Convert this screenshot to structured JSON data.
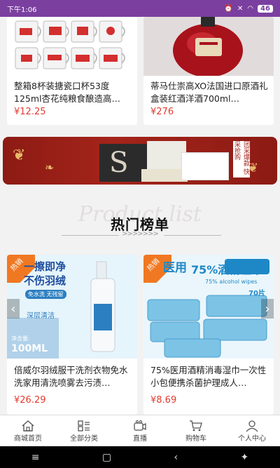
{
  "status_bar": {
    "time": "下午1:06",
    "icons": [
      "alarm-icon",
      "mute-icon",
      "wifi-icon",
      "battery-icon"
    ],
    "battery": "46"
  },
  "top_products": [
    {
      "title": "整箱8杯装搪瓷口杯53度125ml杏花纯粮食酿造高…",
      "price": "¥12.25"
    },
    {
      "title": "蒂马仕崇高XO法国进口原酒礼盒装红酒洋酒700ml…",
      "price": "¥276"
    }
  ],
  "banner": {
    "side_tag": "团采爆款 快采抢购"
  },
  "section": {
    "watermark": "Product list",
    "title": "热门榜单",
    "arrows": ">>>>>>>"
  },
  "hot_products": [
    {
      "badge": "热销",
      "img_text_1": "一擦即净",
      "img_text_2": "不伤羽绒",
      "img_text_3": "免水洗 无残留",
      "img_text_4": "深层清洁",
      "img_text_5": "净含量:",
      "img_text_6": "100ML",
      "title": "倍威尔羽绒服干洗剂衣物免水洗家用清洗喷雾去污渍…",
      "price": "¥26.29"
    },
    {
      "badge": "热销",
      "img_text_1": "医用",
      "img_text_2": "75%酒精湿巾",
      "img_text_3": "75% alcohol wipes",
      "img_text_4": "70片",
      "title": "75%医用酒精消毒湿巾一次性小包便携杀菌护理成人…",
      "price": "¥8.69"
    }
  ],
  "bottom_nav": [
    {
      "label": "商城首页",
      "icon": "home-icon"
    },
    {
      "label": "全部分类",
      "icon": "category-icon"
    },
    {
      "label": "直播",
      "icon": "live-icon"
    },
    {
      "label": "购物车",
      "icon": "cart-icon"
    },
    {
      "label": "个人中心",
      "icon": "user-icon"
    }
  ],
  "colors": {
    "accent": "#7b3fa0",
    "price": "#e23c30",
    "hot_badge": "#f07822",
    "banner": "#a4241a"
  }
}
